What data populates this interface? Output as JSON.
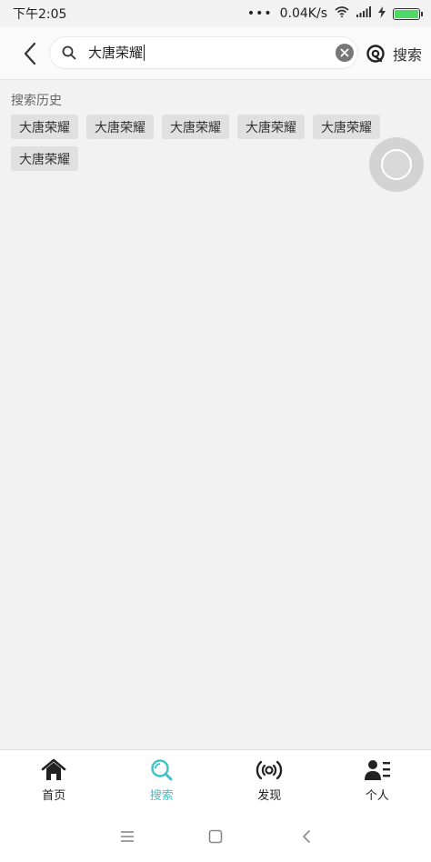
{
  "status_bar": {
    "time": "下午2:05",
    "dots": "•••",
    "network_speed": "0.04K/s",
    "battery_color": "#4cd964"
  },
  "header": {
    "back_icon": "chevron-left-icon",
    "search_icon": "search-icon",
    "search_value": "大唐荣耀",
    "clear_icon": "clear-icon",
    "search_button_icon": "search-logo-icon",
    "search_button_label": "搜索"
  },
  "history": {
    "title": "搜索历史",
    "items": [
      "大唐荣耀",
      "大唐荣耀",
      "大唐荣耀",
      "大唐荣耀",
      "大唐荣耀",
      "大唐荣耀"
    ]
  },
  "tabs": [
    {
      "label": "首页",
      "icon": "home-icon",
      "active": false
    },
    {
      "label": "搜索",
      "icon": "search-icon",
      "active": true
    },
    {
      "label": "发现",
      "icon": "broadcast-icon",
      "active": false
    },
    {
      "label": "个人",
      "icon": "person-icon",
      "active": false
    }
  ],
  "colors": {
    "accent": "#3ec2c8",
    "background": "#f2f2f2",
    "chip_bg": "#e0e0e0"
  }
}
